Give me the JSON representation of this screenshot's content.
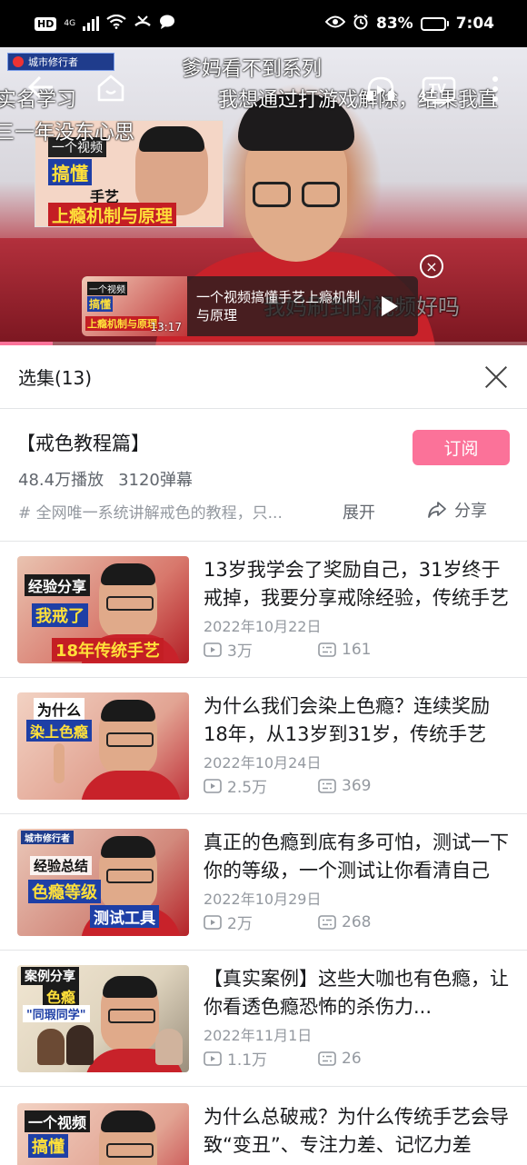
{
  "status_bar": {
    "hd": "HD",
    "network": "4G",
    "battery_percent": "83%",
    "battery_level": 0.83,
    "time": "7:04"
  },
  "player": {
    "channel_logo": "城市修行者",
    "danmaku": [
      "爹妈看不到系列",
      "实名学习",
      "我想通过打游戏解除，结果我直",
      "三一年没东心思",
      "我妈刷到的视频好吗"
    ],
    "overlay_card": {
      "tag": "一个视频",
      "big": "搞懂",
      "mid": "手艺",
      "strip": "上瘾机制与原理"
    },
    "recommend": {
      "title": "一个视频搞懂手艺上瘾机制与原理",
      "duration": "13:17",
      "thumb_a": "一个视频",
      "thumb_b": "搞懂",
      "thumb_c": "上瘾机制与原理"
    },
    "tv_label": "TV",
    "progress": 0.1
  },
  "panel": {
    "title": "选集(13)"
  },
  "season": {
    "name": "【戒色教程篇】",
    "subscribe_label": "订阅",
    "plays": "48.4万播放",
    "danmaku_count": "3120弹幕",
    "description": "# 全网唯一系统讲解戒色的教程，只...",
    "expand_label": "展开",
    "share_label": "分享"
  },
  "episodes": [
    {
      "title": "13岁我学会了奖励自己，31岁终于戒掉，我要分享戒除经验，传统手艺",
      "date": "2022年10月22日",
      "views": "3万",
      "danmaku": "161",
      "tag1": "经验分享",
      "tag2": "我戒了",
      "tag3": "18年传统手艺"
    },
    {
      "title": "为什么我们会染上色瘾？连续奖励18年，从13岁到31岁，传统手艺",
      "date": "2022年10月24日",
      "views": "2.5万",
      "danmaku": "369",
      "tag1": "为什么",
      "tag2": "染上色瘾"
    },
    {
      "title": "真正的色瘾到底有多可怕，测试一下你的等级，一个测试让你看清自己",
      "date": "2022年10月29日",
      "views": "2万",
      "danmaku": "268",
      "tag0": "城市修行者",
      "tag1": "经验总结",
      "tag2": "色瘾等级",
      "tag3": "测试工具"
    },
    {
      "title": "【真实案例】这些大咖也有色瘾，让你看透色瘾恐怖的杀伤力...",
      "date": "2022年11月1日",
      "views": "1.1万",
      "danmaku": "26",
      "tag1": "案例分享",
      "tag2": "色瘾",
      "tag3": "\"同瑕同学\""
    },
    {
      "title": "为什么总破戒？为什么传统手艺会导致“变丑”、专注力差、记忆力差",
      "tag1": "一个视频",
      "tag2": "搞懂"
    }
  ],
  "colors": {
    "accent": "#fb7299",
    "text_primary": "#18191c",
    "text_secondary": "#61666d",
    "text_tertiary": "#9499a0",
    "divider": "#e3e5e7"
  }
}
